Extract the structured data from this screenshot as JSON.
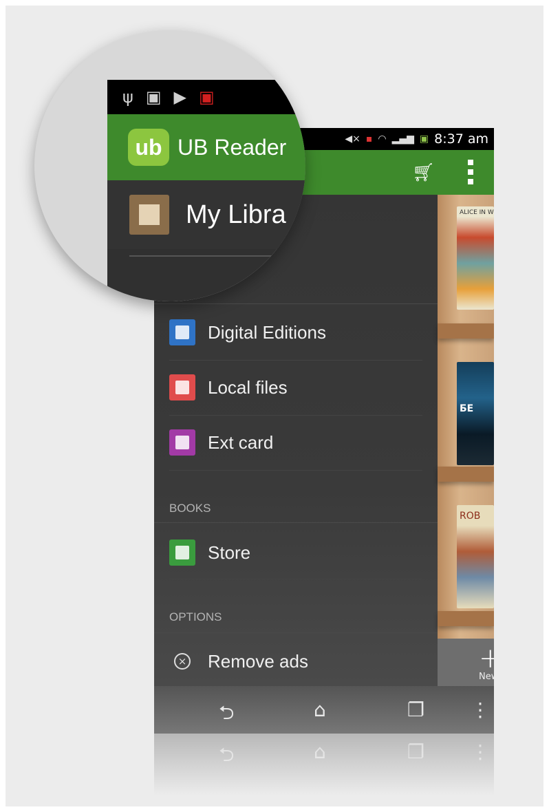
{
  "status_bar": {
    "time": "8:37 am",
    "icons": [
      "mute-icon",
      "sim-icon",
      "wifi-icon",
      "signal-icon",
      "battery-icon"
    ]
  },
  "magnified_status_icons": [
    "usb-icon",
    "android-icon",
    "bag-icon",
    "android-red-icon"
  ],
  "app": {
    "logo_text": "ub",
    "title": "UB Reader",
    "library_title": "My Libra"
  },
  "action_bar": {
    "icons": [
      "cart-icon",
      "overflow-menu-icon"
    ]
  },
  "drawer": {
    "items": [
      {
        "label": "Digital Editions",
        "icon": "digital-editions-icon",
        "color": "#2f73c6"
      },
      {
        "label": "Local files",
        "icon": "local-files-icon",
        "color": "#e04c4c"
      },
      {
        "label": "Ext card",
        "icon": "ext-card-icon",
        "color": "#a23aa6"
      }
    ],
    "sections": {
      "books": "BOOKS",
      "options": "OPTIONS"
    },
    "store": {
      "label": "Store",
      "icon": "store-icon",
      "color": "#3a9c3e"
    },
    "remove_ads": {
      "label": "Remove ads",
      "icon": "close-circle-icon"
    }
  },
  "shelf": {
    "books": [
      {
        "title": "ALICE IN W"
      },
      {
        "title": "БЕ"
      },
      {
        "title": "ROB"
      }
    ],
    "new_button": "New"
  },
  "nav_bar": {
    "icons": [
      "back-icon",
      "home-icon",
      "recents-icon",
      "overflow-icon"
    ]
  },
  "colors": {
    "accent": "#3e8a2c",
    "drawer_bg": "#353535",
    "logo": "#8cc63f"
  }
}
